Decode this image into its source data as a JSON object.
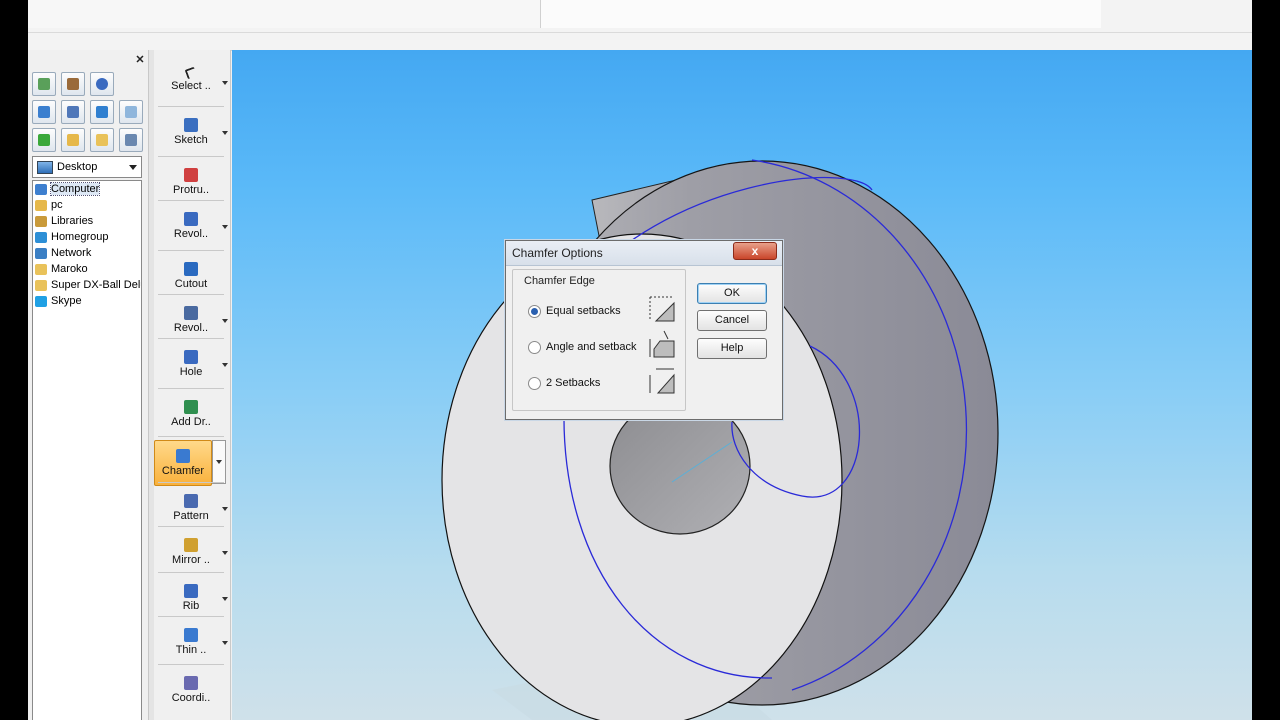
{
  "explorer": {
    "location": "Desktop",
    "items": [
      {
        "label": "Computer",
        "icon": "computer-icon",
        "color": "#3d7fcf"
      },
      {
        "label": "pc",
        "icon": "user-folder-icon",
        "color": "#e6b84a"
      },
      {
        "label": "Libraries",
        "icon": "libraries-icon",
        "color": "#c99a3a"
      },
      {
        "label": "Homegroup",
        "icon": "homegroup-icon",
        "color": "#2d8fd6"
      },
      {
        "label": "Network",
        "icon": "network-icon",
        "color": "#3b7fc4"
      },
      {
        "label": "Maroko",
        "icon": "folder-icon",
        "color": "#e9c25a"
      },
      {
        "label": "Super DX-Ball Delu",
        "icon": "folder-icon",
        "color": "#e9c25a"
      },
      {
        "label": "Skype",
        "icon": "skype-icon",
        "color": "#1fa0e4"
      }
    ]
  },
  "features": {
    "items": [
      {
        "label": "Select ..",
        "icon": "select-arrow-icon",
        "has_dropdown": true
      },
      {
        "label": "Sketch",
        "icon": "sketch-icon",
        "has_dropdown": true
      },
      {
        "label": "Protru..",
        "icon": "protrusion-icon",
        "has_dropdown": false
      },
      {
        "label": "Revol..",
        "icon": "revolved-protrusion-icon",
        "has_dropdown": true
      },
      {
        "label": "Cutout",
        "icon": "cutout-icon",
        "has_dropdown": false
      },
      {
        "label": "Revol..",
        "icon": "revolved-cutout-icon",
        "has_dropdown": true
      },
      {
        "label": "Hole",
        "icon": "hole-icon",
        "has_dropdown": true
      },
      {
        "label": "Add Dr..",
        "icon": "add-draft-icon",
        "has_dropdown": false
      },
      {
        "label": "Chamfer",
        "icon": "chamfer-icon",
        "has_dropdown": true,
        "active": true
      },
      {
        "label": "Pattern",
        "icon": "pattern-icon",
        "has_dropdown": true
      },
      {
        "label": "Mirror ..",
        "icon": "mirror-icon",
        "has_dropdown": true
      },
      {
        "label": "Rib",
        "icon": "rib-icon",
        "has_dropdown": true
      },
      {
        "label": "Thin ..",
        "icon": "thin-wall-icon",
        "has_dropdown": true
      },
      {
        "label": "Coordi..",
        "icon": "coordinate-system-icon",
        "has_dropdown": false
      }
    ]
  },
  "dialog": {
    "title": "Chamfer Options",
    "close_label": "x",
    "group_label": "Chamfer Edge",
    "options": [
      {
        "label": "Equal setbacks",
        "selected": true
      },
      {
        "label": "Angle and setback",
        "selected": false
      },
      {
        "label": "2 Setbacks",
        "selected": false
      }
    ],
    "ok_label": "OK",
    "cancel_label": "Cancel",
    "help_label": "Help"
  },
  "colors": {
    "accent_active": "#f9b13c",
    "edge_highlight": "#2a2ad8",
    "model_face": "#e6e6e8"
  }
}
